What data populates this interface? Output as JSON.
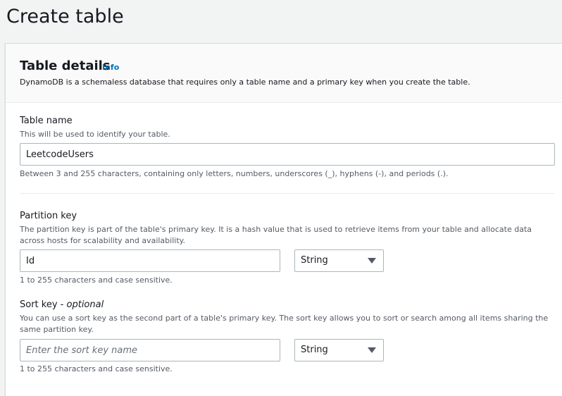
{
  "page": {
    "title": "Create table"
  },
  "panel": {
    "title": "Table details",
    "info_label": "Info",
    "description": "DynamoDB is a schemaless database that requires only a table name and a primary key when you create the table."
  },
  "table_name": {
    "label": "Table name",
    "description": "This will be used to identify your table.",
    "value": "LeetcodeUsers",
    "constraint": "Between 3 and 255 characters, containing only letters, numbers, underscores (_), hyphens (-), and periods (.)."
  },
  "partition_key": {
    "label": "Partition key",
    "description": "The partition key is part of the table's primary key. It is a hash value that is used to retrieve items from your table and allocate data across hosts for scalability and availability.",
    "value": "Id",
    "type_selected": "String",
    "constraint": "1 to 255 characters and case sensitive."
  },
  "sort_key": {
    "label": "Sort key",
    "optional_label": "optional",
    "description": "You can use a sort key as the second part of a table's primary key. The sort key allows you to sort or search among all items sharing the same partition key.",
    "value": "",
    "placeholder": "Enter the sort key name",
    "type_selected": "String",
    "constraint": "1 to 255 characters and case sensitive."
  },
  "icons": {
    "dropdown": "caret-down-icon"
  },
  "colors": {
    "link": "#0073bb",
    "background": "#f2f3f3",
    "text_secondary": "#545b64",
    "border": "#aab7b8"
  }
}
